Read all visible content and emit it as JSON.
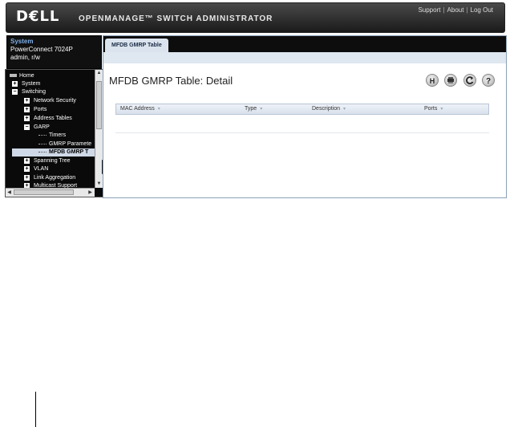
{
  "header": {
    "logo": "D€LL",
    "title": "OPENMANAGE™ SWITCH ADMINISTRATOR",
    "links": [
      "Support",
      "About",
      "Log Out"
    ]
  },
  "system": {
    "title": "System",
    "model": "PowerConnect 7024P",
    "user": "admin, r/w"
  },
  "tree": {
    "items": [
      {
        "label": "Home",
        "icon": "home-icon"
      },
      {
        "label": "System",
        "icon": "plus-icon"
      },
      {
        "label": "Switching",
        "icon": "minus-icon"
      },
      {
        "label": "Network Security",
        "icon": "plus-icon"
      },
      {
        "label": "Ports",
        "icon": "plus-icon"
      },
      {
        "label": "Address Tables",
        "icon": "plus-icon"
      },
      {
        "label": "GARP",
        "icon": "minus-icon"
      },
      {
        "label": "Timers",
        "icon": "leaf-icon"
      },
      {
        "label": "GMRP Paramete",
        "icon": "leaf-icon"
      },
      {
        "label": "MFDB GMRP T",
        "icon": "leaf-icon"
      },
      {
        "label": "Spanning Tree",
        "icon": "plus-icon"
      },
      {
        "label": "VLAN",
        "icon": "plus-icon"
      },
      {
        "label": "Link Aggregation",
        "icon": "plus-icon"
      },
      {
        "label": "Multicast Support",
        "icon": "plus-icon"
      }
    ]
  },
  "content": {
    "tab": "MFDB GMRP Table",
    "page_title": "MFDB GMRP Table: Detail",
    "toolbar": [
      "save-icon",
      "print-icon",
      "refresh-icon",
      "help-icon"
    ],
    "columns": [
      "MAC Address",
      "Type",
      "Description",
      "Ports"
    ]
  }
}
